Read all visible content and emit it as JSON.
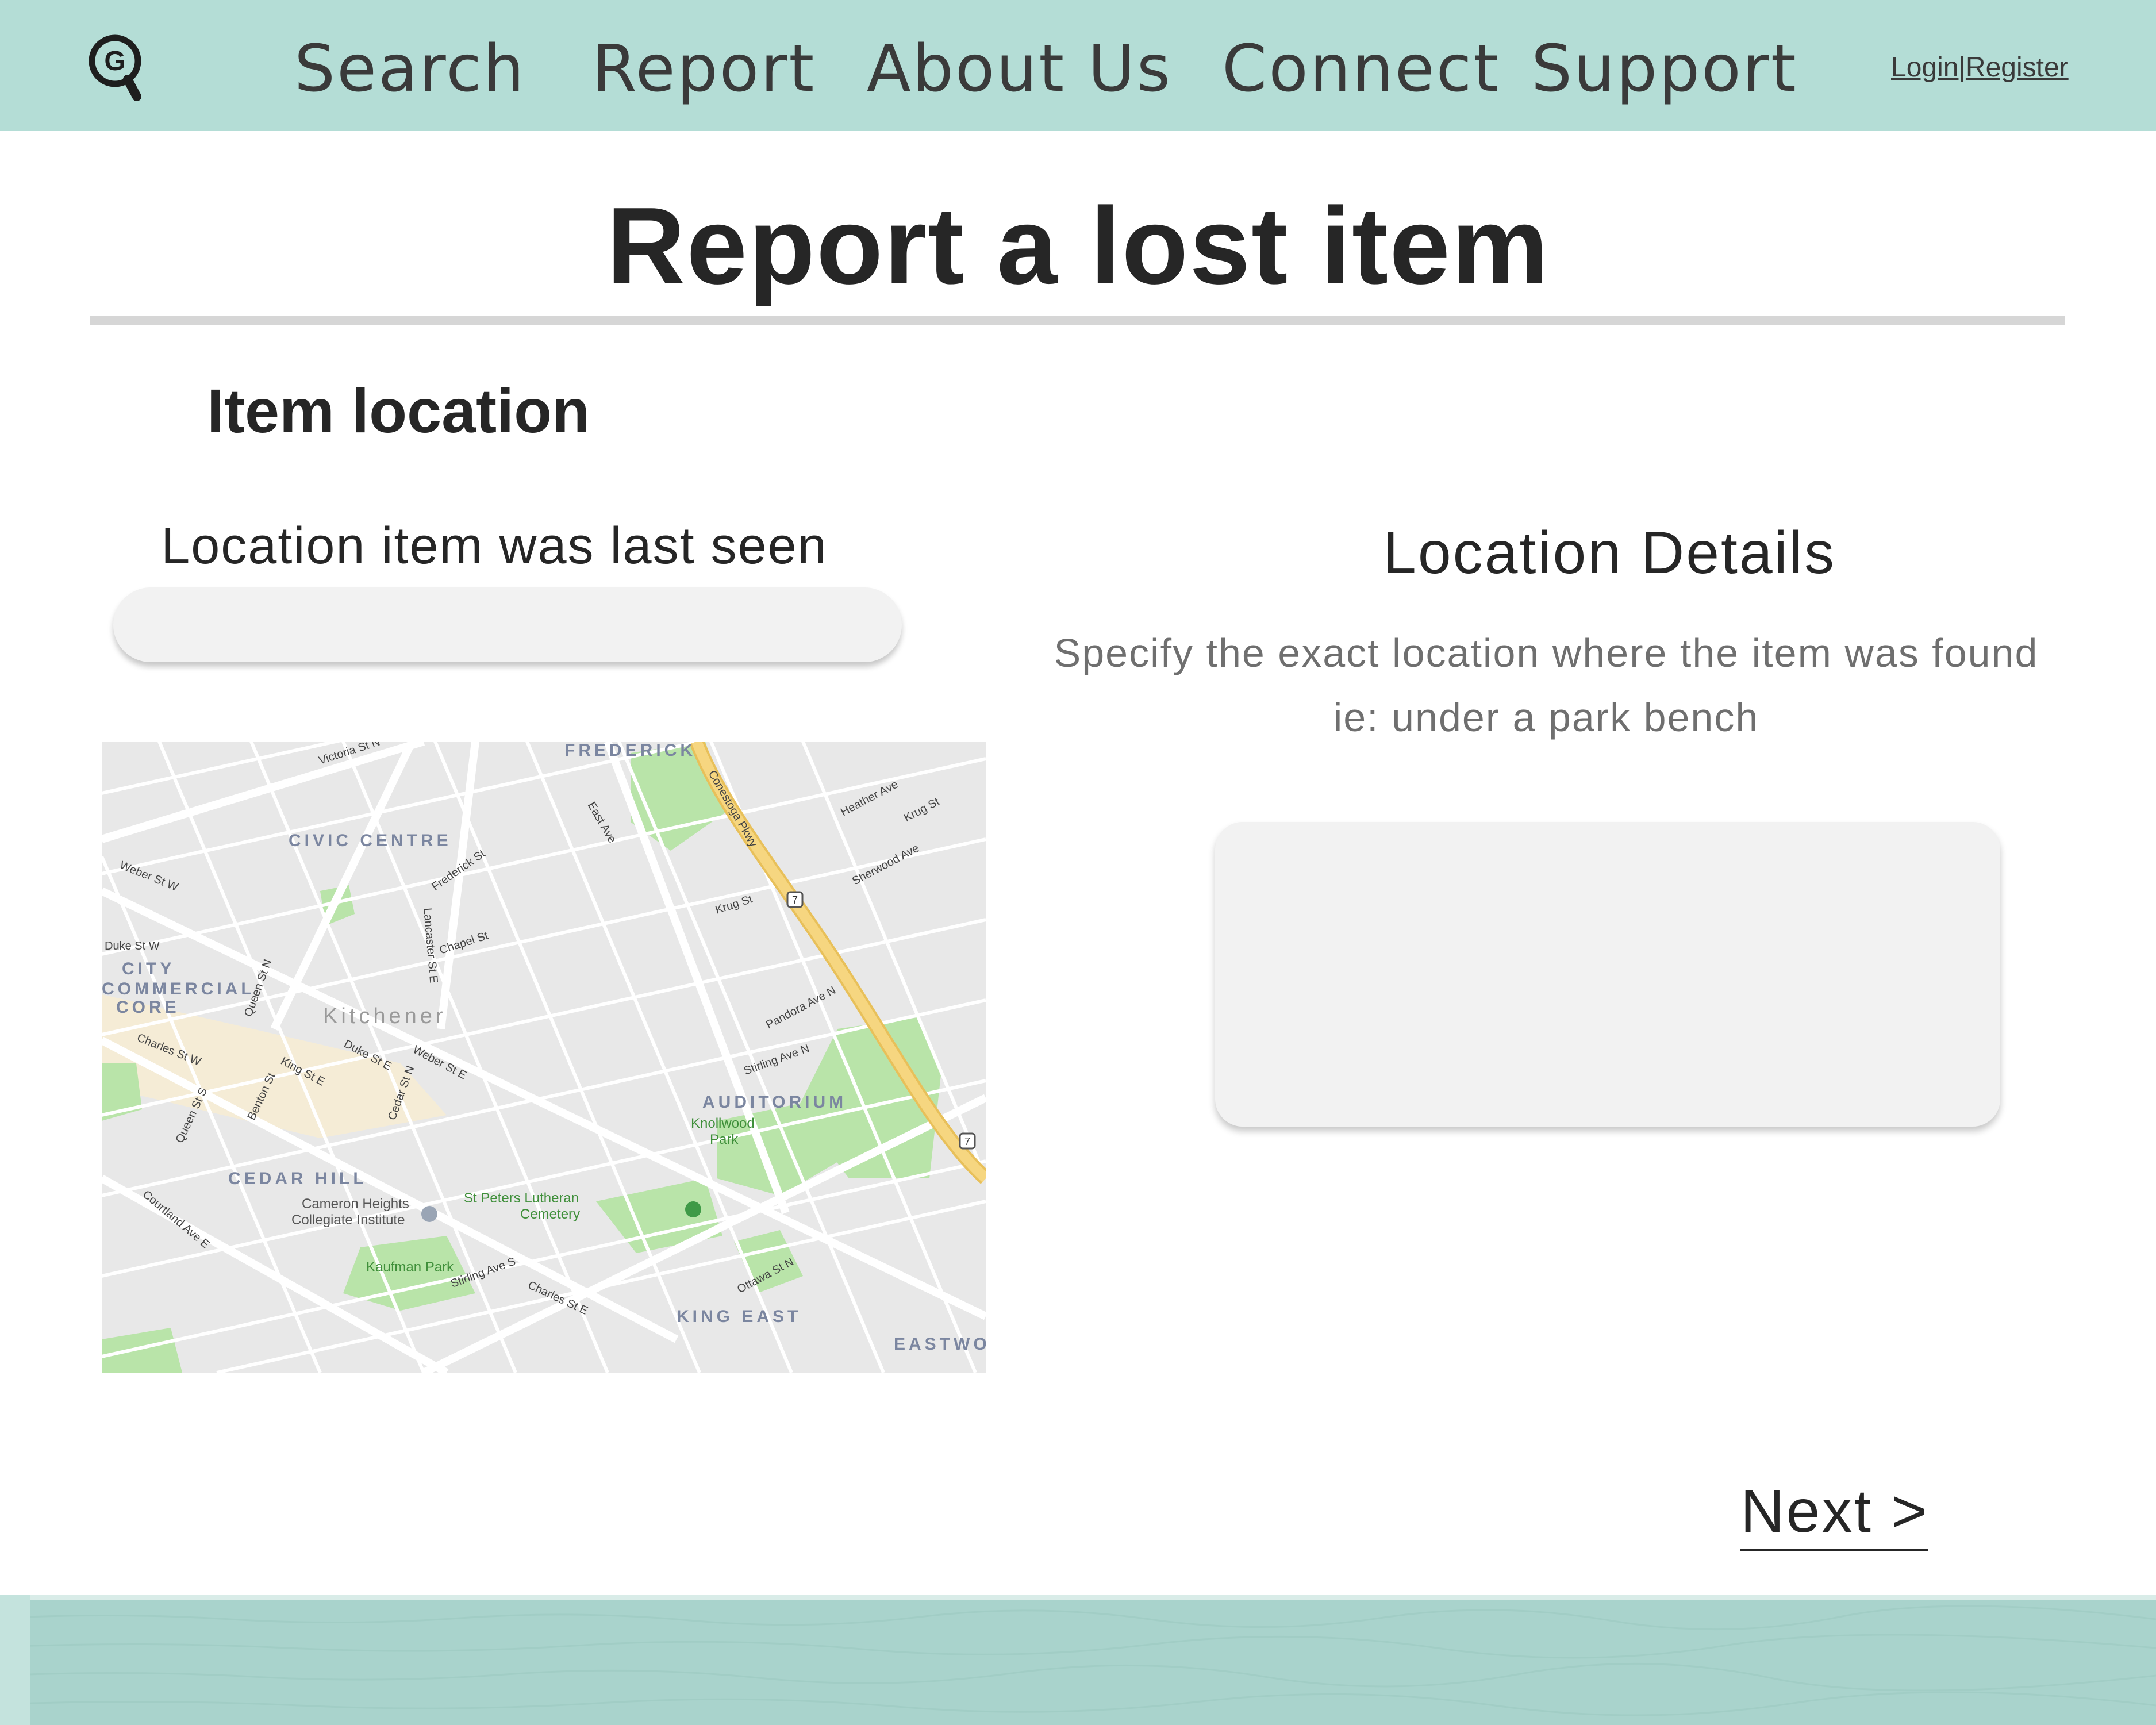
{
  "header": {
    "logo_icon": "magnifier-g-logo-icon",
    "logo_letter": "G",
    "nav": [
      "Search",
      "Report",
      "About Us",
      "Connect",
      "Support"
    ],
    "login": "Login",
    "separator": "|",
    "register": "Register"
  },
  "page": {
    "title": "Report a lost item",
    "section_title": "Item location"
  },
  "location": {
    "label": "Location item was last seen",
    "input_value": ""
  },
  "map": {
    "city": "Kitchener",
    "districts": [
      "FREDERICK",
      "CIVIC CENTRE",
      "CITY",
      "COMMERCIAL",
      "CORE",
      "AUDITORIUM",
      "CEDAR HILL",
      "KING EAST",
      "EASTWO"
    ],
    "parks": [
      "Knollwood",
      "Park",
      "St Peters Lutheran",
      "Cemetery",
      "Kaufman Park"
    ],
    "places": [
      "Cameron Heights",
      "Collegiate Institute"
    ],
    "streets": [
      "Victoria St N",
      "Weber St W",
      "Duke St W",
      "Charles St W",
      "Queen St N",
      "Frederick St",
      "Lancaster St E",
      "Chapel St",
      "Krug St",
      "East Ave",
      "Conestoga Pkwy",
      "King St E",
      "Weber St E",
      "Cedar St N",
      "Courtland Ave E",
      "Stirling Ave S",
      "Charles St E",
      "Ottawa St N",
      "Pandora Ave N",
      "Stirling Ave N",
      "Benton St",
      "Queen St S",
      "Duke St E",
      "Heather Ave",
      "Krug St",
      "Sherwood Ave"
    ],
    "highway_shield": "7",
    "colors": {
      "road": "#ffffff",
      "highway": "#f6d680",
      "park": "#b9e4a9",
      "background": "#e8e8e8",
      "district_label": "#7b86a0"
    }
  },
  "details": {
    "title": "Location Details",
    "help_line1": "Specify the exact location where the item was found",
    "help_line2": "ie: under a park bench",
    "input_value": ""
  },
  "actions": {
    "next": "Next >"
  },
  "colors": {
    "header_bg": "#b4ddd6",
    "footer_bg": "#a9d3cc",
    "input_bg": "#f2f2f2",
    "divider": "#d6d6d6"
  }
}
